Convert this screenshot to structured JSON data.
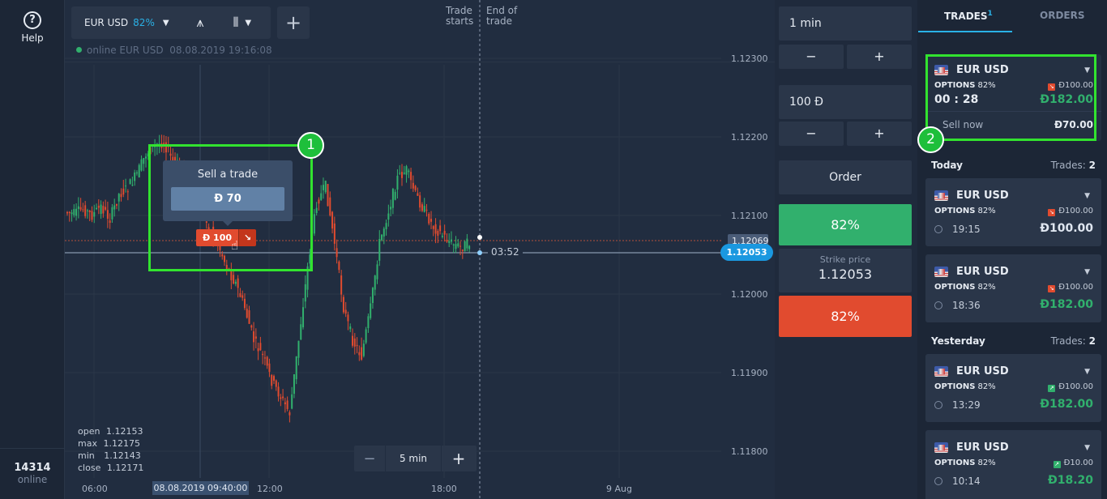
{
  "sidebar": {
    "help_label": "Help",
    "online_count": "14314",
    "online_label": "online"
  },
  "toolbar": {
    "asset": "EUR USD",
    "payout": "82%",
    "add_label": "+"
  },
  "status": {
    "text": "online EUR USD",
    "datetime": "08.08.2019 19:16:08"
  },
  "markers": {
    "trade_starts": [
      "Trade",
      "starts"
    ],
    "end_of_trade": [
      "End of",
      "trade"
    ]
  },
  "y_axis": [
    "1.12300",
    "1.12200",
    "1.12100",
    "1.12000",
    "1.11900",
    "1.11800"
  ],
  "x_axis": [
    "06:00",
    "12:00",
    "18:00",
    "9 Aug"
  ],
  "x_highlight": "08.08.2019 09:40:00",
  "price_tags": {
    "entry": "1.12069",
    "current": "1.12053",
    "countdown": "03:52"
  },
  "ohlc": [
    {
      "k": "open",
      "v": "1.12153"
    },
    {
      "k": "max",
      "v": "1.12175"
    },
    {
      "k": "min",
      "v": "1.12143"
    },
    {
      "k": "close",
      "v": "1.12171"
    }
  ],
  "zoom": {
    "minus": "−",
    "value": "5 min",
    "plus": "+"
  },
  "popup": {
    "title": "Sell a trade",
    "value": "Đ 70"
  },
  "deal_marker": {
    "amount": "Đ 100",
    "arrow": "↘"
  },
  "badges": [
    "1",
    "2"
  ],
  "order_panel": {
    "time_value": "1 min",
    "amount_value": "100 Đ",
    "minus": "−",
    "plus": "+",
    "order_label": "Order",
    "up_pct": "82%",
    "strike_label": "Strike price",
    "strike_value": "1.12053",
    "down_pct": "82%"
  },
  "trades_panel": {
    "tab_trades": "TRADES",
    "tab_trades_count": "1",
    "tab_orders": "ORDERS",
    "active": {
      "asset": "EUR USD",
      "options_label": "OPTIONS",
      "pct": "82%",
      "stake": "Đ100.00",
      "timer": "00 : 28",
      "payout": "Đ182.00",
      "sell_label": "Sell now",
      "sell_value": "Đ70.00"
    },
    "today": {
      "label": "Today",
      "count_label": "Trades:",
      "count": "2",
      "items": [
        {
          "asset": "EUR USD",
          "options_label": "OPTIONS",
          "pct": "82%",
          "stake": "Đ100.00",
          "time": "19:15",
          "value": "Đ100.00",
          "dir": "down"
        },
        {
          "asset": "EUR USD",
          "options_label": "OPTIONS",
          "pct": "82%",
          "stake": "Đ100.00",
          "time": "18:36",
          "value": "Đ182.00",
          "dir": "down"
        }
      ]
    },
    "yesterday": {
      "label": "Yesterday",
      "count_label": "Trades:",
      "count": "2",
      "items": [
        {
          "asset": "EUR USD",
          "options_label": "OPTIONS",
          "pct": "82%",
          "stake": "Đ100.00",
          "time": "13:29",
          "value": "Đ182.00",
          "dir": "up"
        },
        {
          "asset": "EUR USD",
          "options_label": "OPTIONS",
          "pct": "82%",
          "stake": "Đ10.00",
          "time": "10:14",
          "value": "Đ18.20",
          "dir": "up"
        }
      ]
    }
  },
  "colors": {
    "green": "#31b06d",
    "red": "#e14b2f",
    "accent": "#2ab1e6",
    "highlight": "#32e32f"
  }
}
